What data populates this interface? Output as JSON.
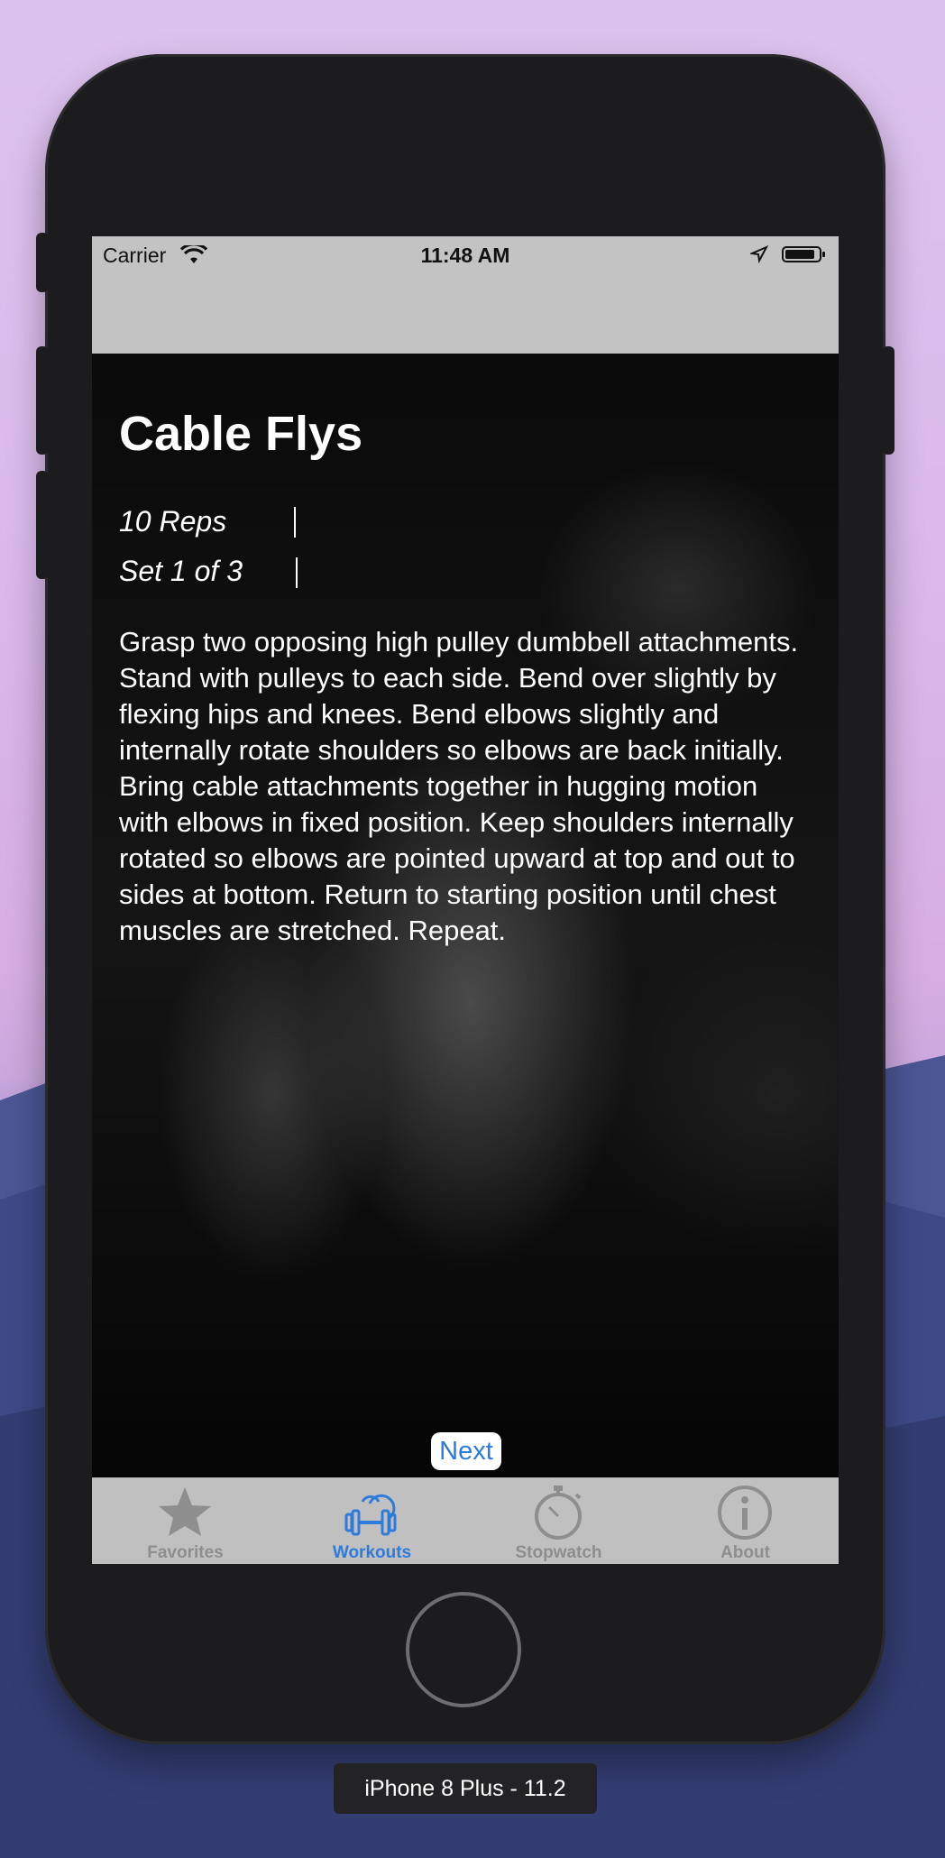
{
  "status_bar": {
    "carrier": "Carrier",
    "time": "11:48 AM",
    "wifi_icon": "wifi-icon",
    "location_icon": "location-arrow-icon",
    "battery_icon": "battery-icon"
  },
  "exercise": {
    "title": "Cable Flys",
    "reps": "10 Reps",
    "set": "Set 1 of 3",
    "description": "Grasp two opposing high pulley dumbbell attachments. Stand with pulleys to each side. Bend over slightly by flexing hips and knees. Bend elbows slightly and internally rotate shoulders so elbows are back initially. Bring cable attachments together in hugging motion with elbows in fixed position. Keep shoulders internally rotated so elbows are pointed upward at top and out to sides at bottom. Return to starting position until chest muscles are stretched. Repeat.",
    "next_label": "Next"
  },
  "tabbar": {
    "items": [
      {
        "label": "Favorites",
        "icon": "star-icon",
        "active": false
      },
      {
        "label": "Workouts",
        "icon": "dumbbell-icon",
        "active": true
      },
      {
        "label": "Stopwatch",
        "icon": "stopwatch-icon",
        "active": false
      },
      {
        "label": "About",
        "icon": "info-icon",
        "active": false
      }
    ],
    "active_color": "#2f7bdc",
    "inactive_color": "#8e8e8e"
  },
  "simulator": {
    "device_label": "iPhone 8 Plus - 11.2"
  }
}
